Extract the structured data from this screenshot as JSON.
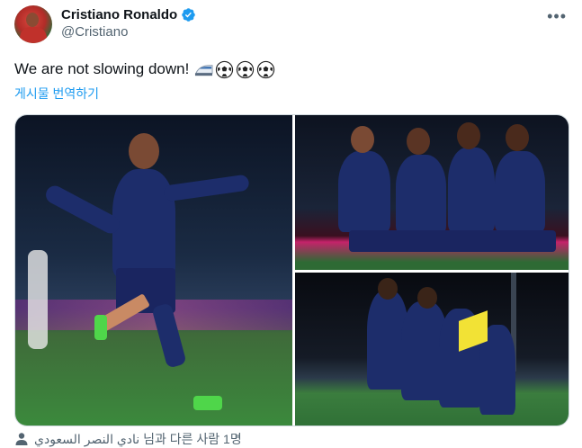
{
  "author": {
    "display_name": "Cristiano Ronaldo",
    "handle": "@Cristiano",
    "verified": true
  },
  "more_icon": "more-horizontal-icon",
  "tweet": {
    "text": "We are not slowing down!",
    "emojis": [
      "bullet-train-icon",
      "soccer-ball-icon",
      "soccer-ball-icon",
      "soccer-ball-icon"
    ]
  },
  "translate_link": "게시물 번역하기",
  "media": {
    "count": 3
  },
  "tagged": {
    "icon": "person-icon",
    "text": "نادي النصر السعودي 님과 다른 사람 1명"
  },
  "colors": {
    "link": "#1d9bf0",
    "secondary": "#536471",
    "verified": "#1d9bf0"
  }
}
